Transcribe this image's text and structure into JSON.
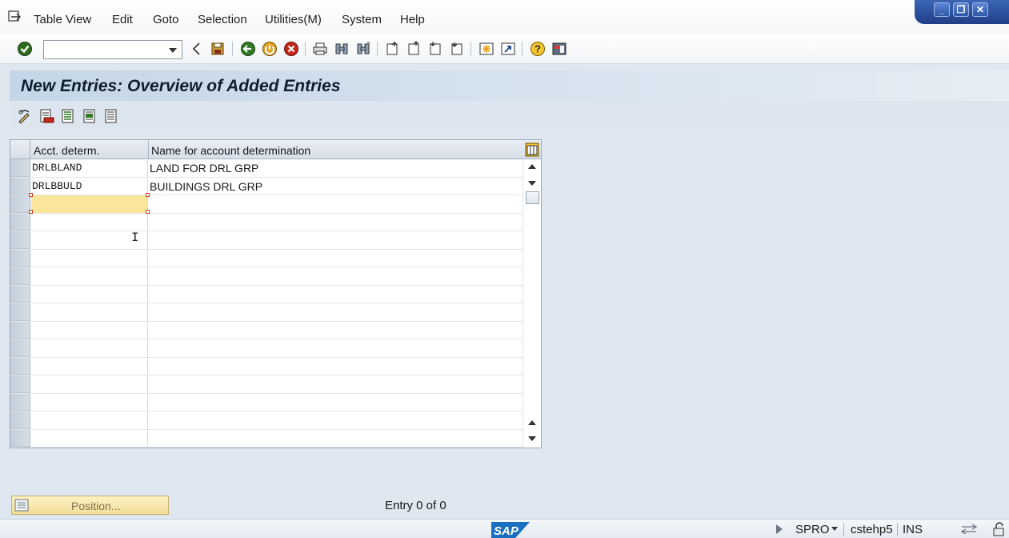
{
  "menu": {
    "items": [
      {
        "label": "Table View"
      },
      {
        "label": "Edit"
      },
      {
        "label": "Goto"
      },
      {
        "label": "Selection"
      },
      {
        "label": "Utilities(M)"
      },
      {
        "label": "System"
      },
      {
        "label": "Help"
      }
    ]
  },
  "window_controls": {
    "minimize": "_",
    "restore": "❐",
    "close": "✕"
  },
  "toolbar": {
    "command_field_value": "",
    "icons": [
      "enter-icon",
      "back-icon",
      "save-icon",
      "back-green-icon",
      "exit-icon",
      "cancel-icon",
      "print-icon",
      "find-icon",
      "find-next-icon",
      "first-page-icon",
      "previous-page-icon",
      "next-page-icon",
      "last-page-icon",
      "create-session-icon",
      "shortcut-icon",
      "help-icon",
      "customize-layout-icon"
    ]
  },
  "page": {
    "title": "New Entries: Overview of Added Entries"
  },
  "app_toolbar": {
    "icons": [
      "change-display-icon",
      "delete-icon",
      "select-all-icon",
      "select-block-icon",
      "deselect-all-icon"
    ]
  },
  "table": {
    "headers": [
      "Acct. determ.",
      "Name for account determination"
    ],
    "rows": [
      {
        "acct": "DRLBLAND",
        "name": "LAND FOR DRL GRP"
      },
      {
        "acct": "DRLBBULD",
        "name": "BUILDINGS DRL GRP"
      },
      {
        "acct": "",
        "name": ""
      },
      {
        "acct": "",
        "name": ""
      },
      {
        "acct": "",
        "name": ""
      },
      {
        "acct": "",
        "name": ""
      },
      {
        "acct": "",
        "name": ""
      },
      {
        "acct": "",
        "name": ""
      },
      {
        "acct": "",
        "name": ""
      },
      {
        "acct": "",
        "name": ""
      },
      {
        "acct": "",
        "name": ""
      },
      {
        "acct": "",
        "name": ""
      },
      {
        "acct": "",
        "name": ""
      },
      {
        "acct": "",
        "name": ""
      },
      {
        "acct": "",
        "name": ""
      },
      {
        "acct": "",
        "name": ""
      }
    ]
  },
  "footer": {
    "position_label": "Position...",
    "entry_text": "Entry 0 of 0"
  },
  "status": {
    "transaction": "SPRO",
    "server": "cstehp5",
    "mode": "INS",
    "logo": "SAP"
  },
  "colors": {
    "accent": "#2d56a6",
    "active_cell": "#fbe59a",
    "title_band": "#c5d6e8"
  }
}
